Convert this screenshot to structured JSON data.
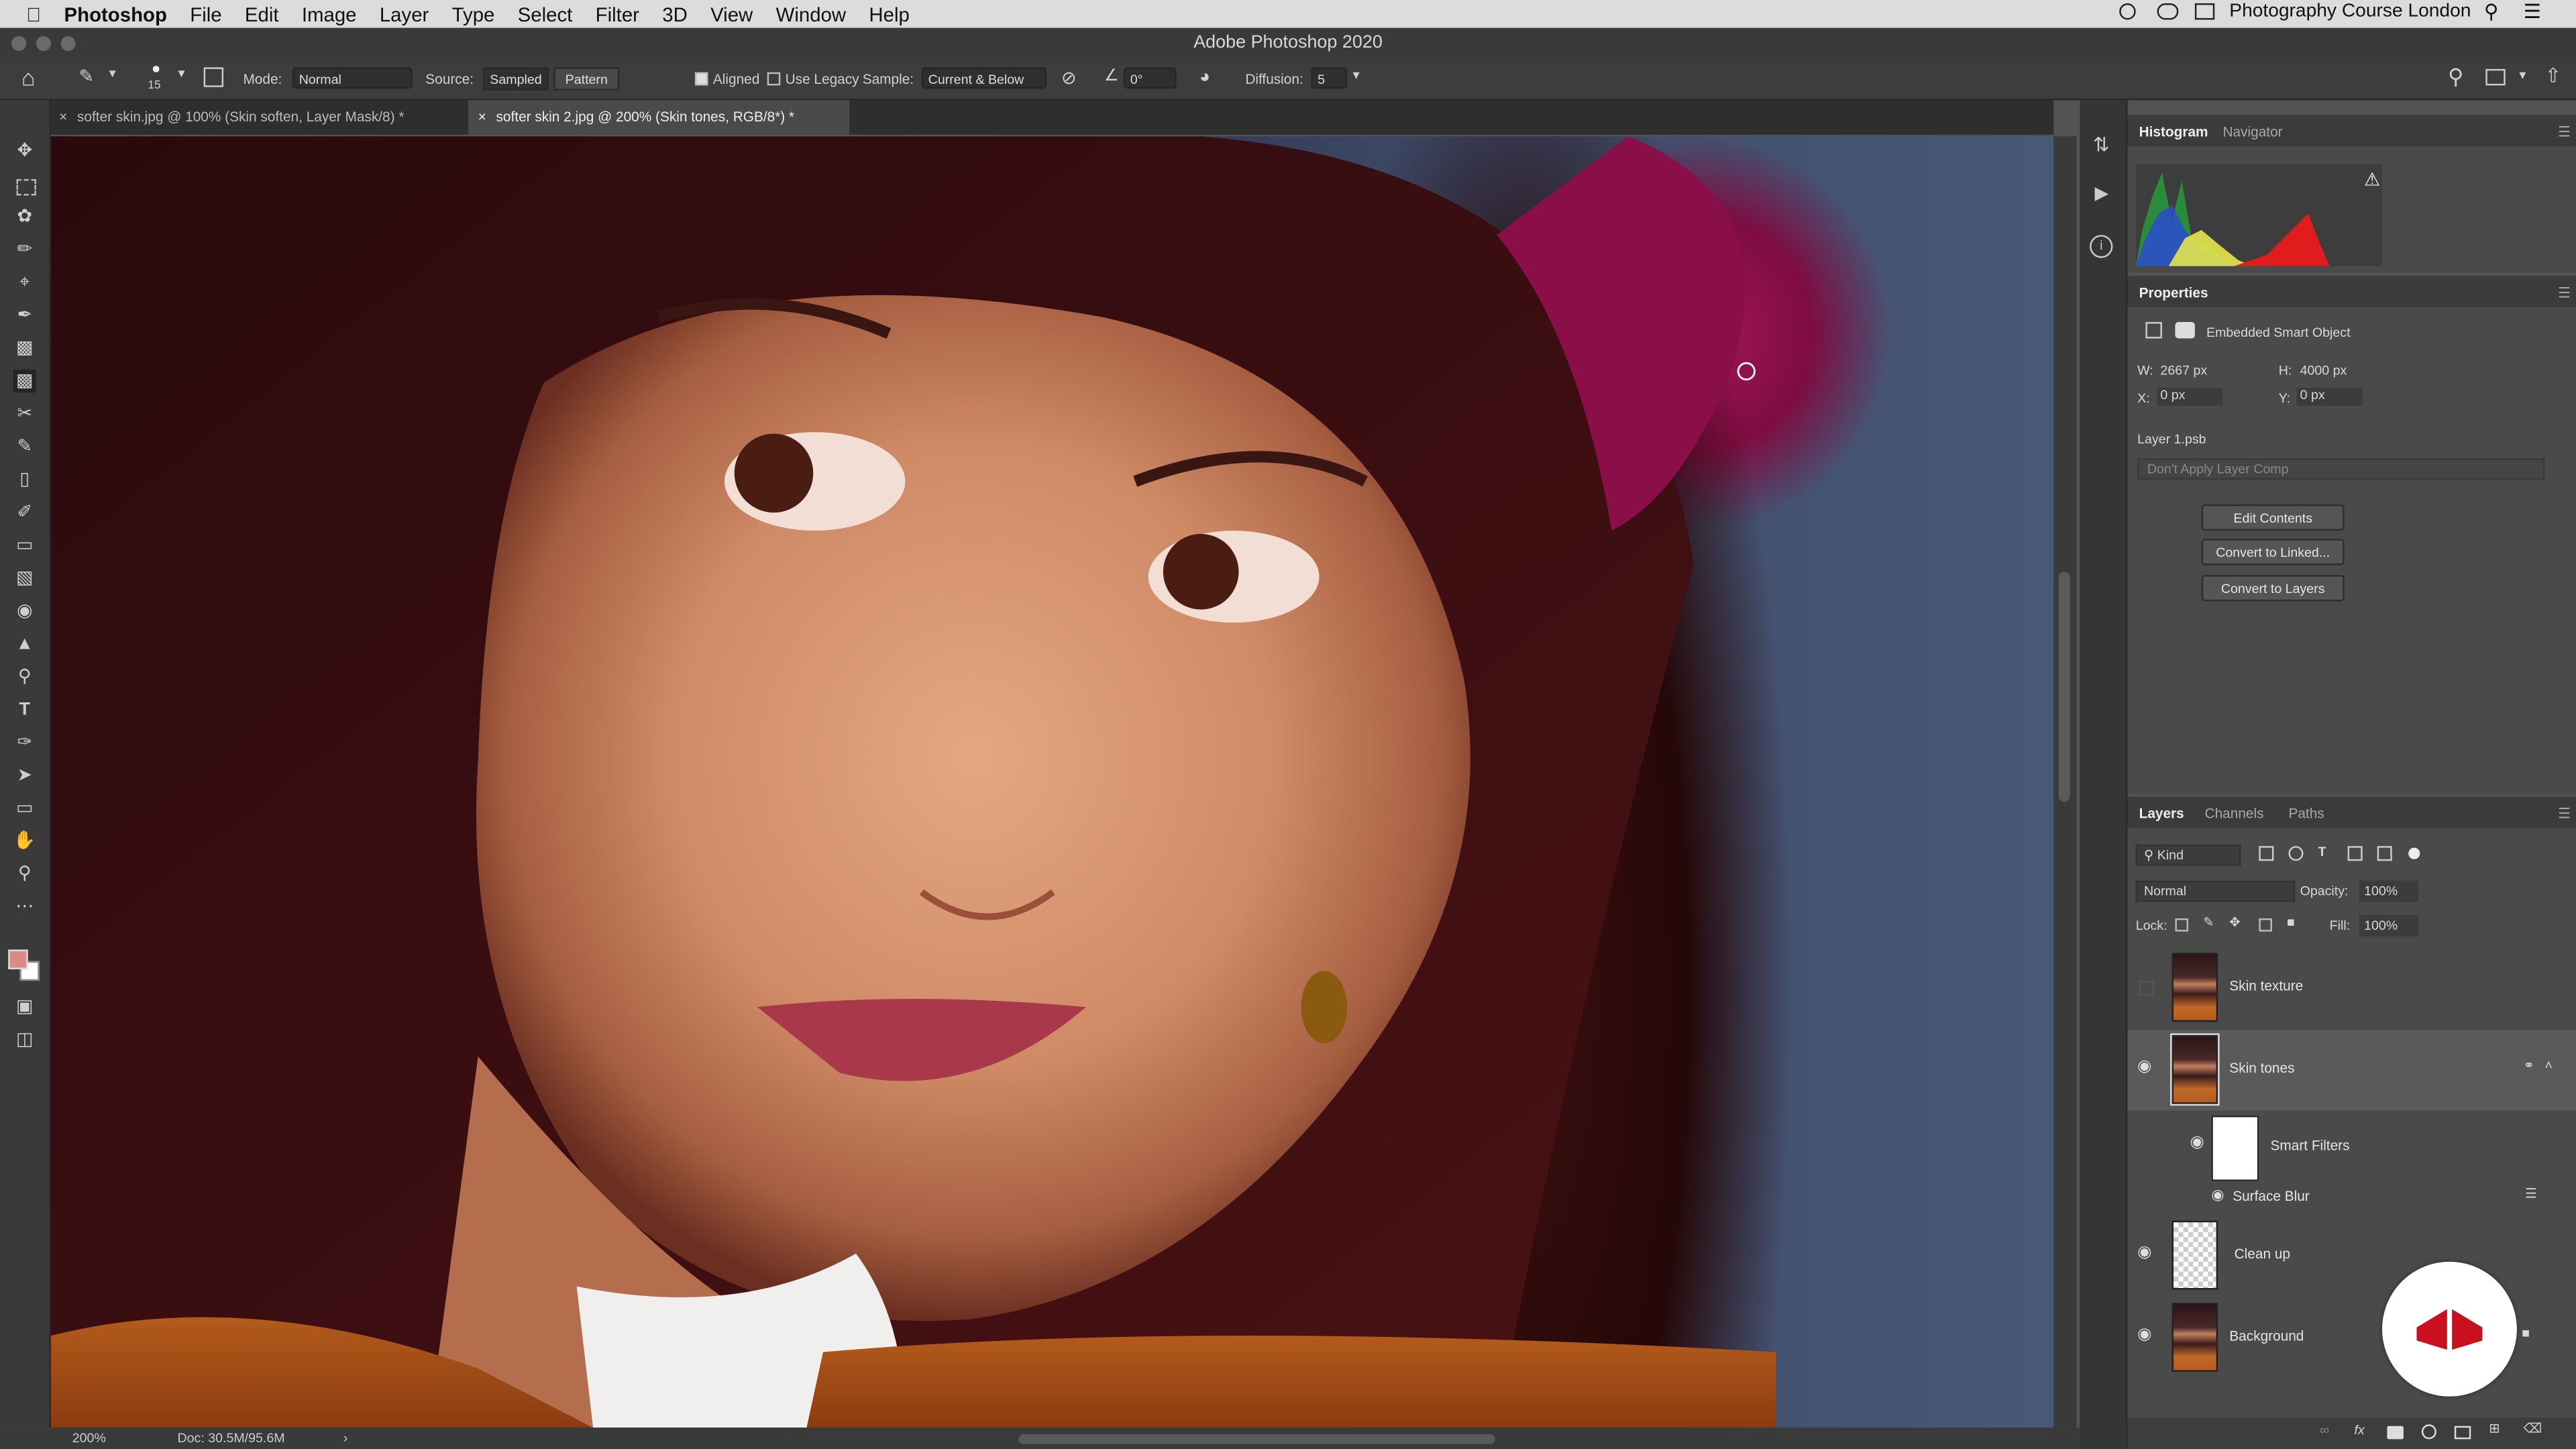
{
  "menubar": {
    "app_name": "Photoshop",
    "items": [
      "File",
      "Edit",
      "Image",
      "Layer",
      "Type",
      "Select",
      "Filter",
      "3D",
      "View",
      "Window",
      "Help"
    ],
    "right_text": "Photography Course London"
  },
  "window": {
    "title": "Adobe Photoshop 2020"
  },
  "options_bar": {
    "brush_size": "15",
    "mode_label": "Mode:",
    "mode_value": "Normal",
    "source_label": "Source:",
    "source_sampled": "Sampled",
    "source_pattern": "Pattern",
    "aligned_label": "Aligned",
    "use_legacy_label": "Use Legacy",
    "sample_label": "Sample:",
    "sample_value": "Current & Below",
    "angle_value": "0°",
    "diffusion_label": "Diffusion:",
    "diffusion_value": "5"
  },
  "tabs": [
    {
      "label": "softer skin.jpg @ 100% (Skin soften, Layer Mask/8) *"
    },
    {
      "label": "softer skin 2.jpg @ 200% (Skin tones, RGB/8*) *"
    }
  ],
  "status": {
    "zoom": "200%",
    "doc": "Doc: 30.5M/95.6M"
  },
  "histogram_panel": {
    "tabs": [
      "Histogram",
      "Navigator"
    ]
  },
  "properties_panel": {
    "title": "Properties",
    "type": "Embedded Smart Object",
    "w_label": "W:",
    "w_value": "2667 px",
    "h_label": "H:",
    "h_value": "4000 px",
    "x_label": "X:",
    "x_value": "0 px",
    "y_label": "Y:",
    "y_value": "0 px",
    "file": "Layer 1.psb",
    "layer_comp": "Don't Apply Layer Comp",
    "buttons": [
      "Edit Contents",
      "Convert to Linked...",
      "Convert to Layers"
    ]
  },
  "layers_panel": {
    "tabs": [
      "Layers",
      "Channels",
      "Paths"
    ],
    "kind_label": "Kind",
    "blend_mode": "Normal",
    "opacity_label": "Opacity:",
    "opacity_value": "100%",
    "lock_label": "Lock:",
    "fill_label": "Fill:",
    "fill_value": "100%",
    "layers": [
      {
        "name": "Skin texture"
      },
      {
        "name": "Skin tones"
      },
      {
        "name": "Smart Filters"
      },
      {
        "name": "Surface Blur"
      },
      {
        "name": "Clean up"
      },
      {
        "name": "Background"
      }
    ]
  },
  "colors": {
    "foreground": "#d98a8a",
    "background": "#ffffff",
    "logo_red": "#c8101e"
  }
}
